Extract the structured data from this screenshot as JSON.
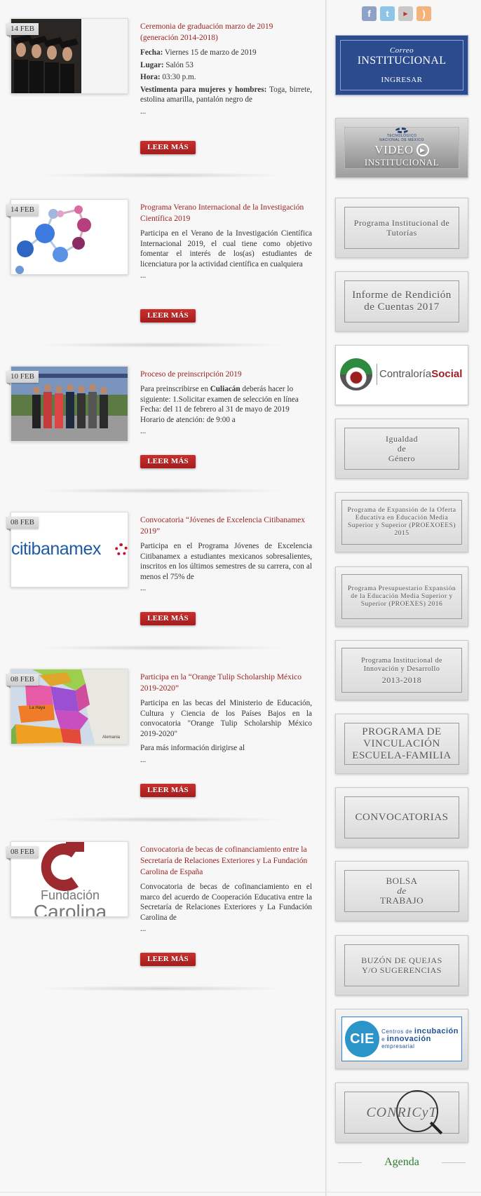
{
  "news": [
    {
      "date": "14 FEB",
      "title": "Ceremonia de graduación marzo de 2019 (generación 2014-2018)",
      "lines": [
        {
          "label": "Fecha:",
          "text": " Viernes 15 de marzo de 2019"
        },
        {
          "label": "Lugar:",
          "text": " Salón 53"
        },
        {
          "label": "Hora:",
          "text": " 03:30 p.m."
        },
        {
          "label": "Vestimenta para mujeres y hombres:",
          "text": " Toga, birrete, estolina amarilla, pantalón negro de"
        }
      ],
      "ellipsis": "...",
      "button": "LEER MÁS",
      "thumb": "graduates-photo"
    },
    {
      "date": "14 FEB",
      "title": "Programa Verano Internacional de la Investigación Científica 2019",
      "text": "Participa en el Verano de la Investigación Científica Internacional 2019, el cual tiene como objetivo fomentar el interés de los(as) estudiantes de licenciatura por la actividad científica en cualquiera",
      "ellipsis": "...",
      "button": "LEER MÁS",
      "thumb": "molecule-illustration"
    },
    {
      "date": "10 FEB",
      "title": "Proceso de preinscripción 2019",
      "text_pre": "Para preinscribirse en ",
      "text_bold": "Culiacán",
      "text_post": " deberás hacer lo siguiente: 1.Solicitar examen de selección en línea Fecha: del 11 de febrero al 31 de mayo de 2019 Horario de atención: de 9:00 a",
      "ellipsis": "...",
      "button": "LEER MÁS",
      "thumb": "students-photo"
    },
    {
      "date": "08 FEB",
      "title": "Convocatoria “Jóvenes de Excelencia Citibanamex 2019”",
      "text": "Participa en el Programa Jóvenes de Excelencia Citibanamex a estudiantes mexicanos sobresalientes, inscritos en los últimos semestres de su carrera, con al menos el 75% de",
      "ellipsis": "...",
      "button": "LEER MÁS",
      "thumb": "citibanamex-logo",
      "logo_text": "citibanamex"
    },
    {
      "date": "08 FEB",
      "title": "Participa en la “Orange Tulip Scholarship México 2019-2020”",
      "text": "Participa en las becas del Ministerio de Educación, Cultura y Ciencia de los Países Bajos en la convocatoria \"Orange Tulip Scholarship México 2019-2020\"",
      "text2": "Para más información dirigirse al",
      "ellipsis": "...",
      "button": "LEER MÁS",
      "thumb": "netherlands-map",
      "map_label": "Alemania",
      "map_label2": "La Haya"
    },
    {
      "date": "08 FEB",
      "title": "Convocatoria de becas de cofinanciamiento entre la Secretaría de Relaciones Exteriores y La Fundación Carolina de España",
      "text": "Convocatoria de becas de cofinanciamiento en el marco del acuerdo de Cooperación Educativa entre la Secretaría de Relaciones Exteriores y La Fundación Carolina de",
      "ellipsis": "...",
      "button": "LEER MÁS",
      "thumb": "fundacion-carolina-logo",
      "logo_text1": "Fundación",
      "logo_text2": "Carolina"
    }
  ],
  "social": [
    "facebook-icon",
    "twitter-icon",
    "youtube-icon",
    "rss-icon"
  ],
  "sidebar": {
    "correo": {
      "line1": "Correo",
      "line2": "INSTITUCIONAL",
      "line3": "INGRESAR"
    },
    "video": {
      "caption1": "TECNOLÓGICO",
      "caption2": "NACIONAL DE MÉXICO",
      "line1": "VIDEO",
      "line2": "INSTITUCIONAL"
    },
    "tutorias": "Programa Institucional de Tutorías",
    "informe": "Informe de Rendición de Cuentas 2017",
    "contraloria": {
      "text1": "Contraloría",
      "text2": "Social"
    },
    "igualdad": {
      "l1": "Igualdad",
      "l2": "de",
      "l3": "Género"
    },
    "proexoees": "Programa de Expansión de la Oferta Educativa en Educación Media Superior y Superior (PROEXOEES) 2015",
    "proexes": "Programa Presupuestario Expansión de la Educación Media Superior y Superior (PROEXES) 2016",
    "innovacion": {
      "text": "Programa Institucional de Innovación y Desarrollo",
      "years": "2013-2018"
    },
    "vinculacion": "PROGRAMA DE VINCULACIÓN ESCUELA-FAMILIA",
    "convocatorias": "CONVOCATORIAS",
    "bolsa": {
      "l1": "BOLSA",
      "l2": "de",
      "l3": "TRABAJO"
    },
    "buzon": {
      "l1": "BUZÓN DE QUEJAS",
      "l2": "Y/O SUGERENCIAS"
    },
    "cie": {
      "logo": "CIE",
      "t1": "Centros de ",
      "t2": "incubación",
      "t3": "e ",
      "t4": "innovación",
      "t5": " empresarial"
    },
    "conricyt": "CONRICyT",
    "agenda": "Agenda"
  },
  "colors": {
    "accent_red": "#9b1f1f",
    "button_red": "#b52525",
    "agenda_green": "#2f7d2f",
    "correo_blue": "#2c4b8f"
  }
}
